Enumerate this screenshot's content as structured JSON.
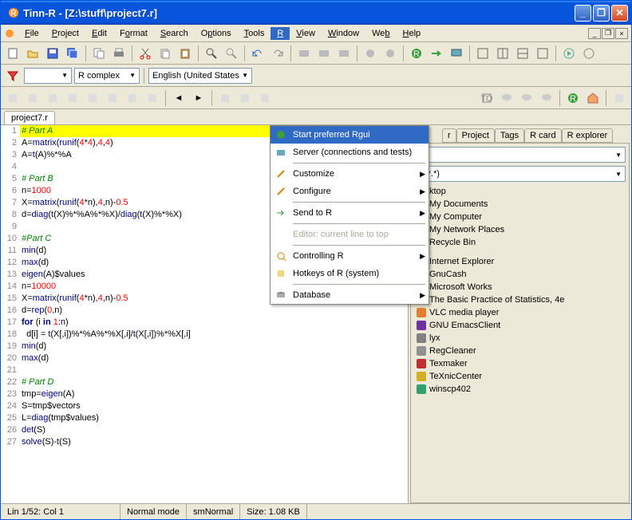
{
  "window": {
    "title": "Tinn-R - [Z:\\stuff\\project7.r]"
  },
  "menu": {
    "file": "File",
    "project": "Project",
    "edit": "Edit",
    "format": "Format",
    "search": "Search",
    "options": "Options",
    "tools": "Tools",
    "r": "R",
    "view": "View",
    "window": "Window",
    "web": "Web",
    "help": "Help"
  },
  "toolbar": {
    "combo1": "R complex",
    "combo2": "English (United States"
  },
  "editor": {
    "tab": "project7.r",
    "lines": [
      {
        "n": "1",
        "cls": "hl",
        "txt": "# Part A"
      },
      {
        "n": "2",
        "cls": "",
        "txt": "A=matrix(runif(4*4),4,4)"
      },
      {
        "n": "3",
        "cls": "",
        "txt": "A=t(A)%*%A"
      },
      {
        "n": "4",
        "cls": "",
        "txt": ""
      },
      {
        "n": "5",
        "cls": "cm",
        "txt": "# Part B"
      },
      {
        "n": "6",
        "cls": "",
        "txt": "n=1000"
      },
      {
        "n": "7",
        "cls": "",
        "txt": "X=matrix(runif(4*n),4,n)-0.5"
      },
      {
        "n": "8",
        "cls": "",
        "txt": "d=diag(t(X)%*%A%*%X)/diag(t(X)%*%X)"
      },
      {
        "n": "9",
        "cls": "",
        "txt": ""
      },
      {
        "n": "10",
        "cls": "cm",
        "txt": "#Part C"
      },
      {
        "n": "11",
        "cls": "",
        "txt": "min(d)"
      },
      {
        "n": "12",
        "cls": "",
        "txt": "max(d)"
      },
      {
        "n": "13",
        "cls": "",
        "txt": "eigen(A)$values"
      },
      {
        "n": "14",
        "cls": "",
        "txt": "n=10000"
      },
      {
        "n": "15",
        "cls": "",
        "txt": "X=matrix(runif(4*n),4,n)-0.5"
      },
      {
        "n": "16",
        "cls": "",
        "txt": "d=rep(0,n)"
      },
      {
        "n": "17",
        "cls": "",
        "txt": "for (i in 1:n)"
      },
      {
        "n": "18",
        "cls": "",
        "txt": "  d[i] = t(X[,i])%*%A%*%X[,i]/t(X[,i])%*%X[,i]"
      },
      {
        "n": "19",
        "cls": "",
        "txt": "min(d)"
      },
      {
        "n": "20",
        "cls": "",
        "txt": "max(d)"
      },
      {
        "n": "21",
        "cls": "",
        "txt": ""
      },
      {
        "n": "22",
        "cls": "cm",
        "txt": "# Part D"
      },
      {
        "n": "23",
        "cls": "",
        "txt": "tmp=eigen(A)"
      },
      {
        "n": "24",
        "cls": "",
        "txt": "S=tmp$vectors"
      },
      {
        "n": "25",
        "cls": "",
        "txt": "L=diag(tmp$values)"
      },
      {
        "n": "26",
        "cls": "",
        "txt": "det(S)"
      },
      {
        "n": "27",
        "cls": "",
        "txt": "solve(S)-t(S)"
      }
    ]
  },
  "rmenu": {
    "items": [
      {
        "label": "Start preferred Rgui",
        "hl": true,
        "arrow": false
      },
      {
        "label": "Server (connections and tests)",
        "arrow": false
      },
      {
        "sep": true
      },
      {
        "label": "Customize",
        "arrow": true
      },
      {
        "label": "Configure",
        "arrow": true
      },
      {
        "sep": true
      },
      {
        "label": "Send to R",
        "arrow": true
      },
      {
        "sep": true
      },
      {
        "label": "Editor: current line to top",
        "disabled": true
      },
      {
        "sep": true
      },
      {
        "label": "Controlling R",
        "arrow": true
      },
      {
        "label": "Hotkeys of R (system)",
        "arrow": false
      },
      {
        "sep": true
      },
      {
        "label": "Database",
        "arrow": true
      }
    ]
  },
  "side": {
    "tabs": [
      "r",
      "Project",
      "Tags",
      "R card",
      "R explorer"
    ],
    "combo1": "",
    "combo2": "ll (*.*)",
    "places": [
      "ktop",
      "My Documents",
      "My Computer",
      "My Network Places",
      "Recycle Bin"
    ],
    "apps": [
      "Internet Explorer",
      "GnuCash",
      "Microsoft Works",
      "The Basic Practice of Statistics, 4e",
      "VLC media player",
      "GNU EmacsClient",
      "lyx",
      "RegCleaner",
      "Texmaker",
      "TeXnicCenter",
      "winscp402"
    ]
  },
  "status": {
    "pos": "Lin 1/52: Col 1",
    "mode": "Normal mode",
    "sm": "smNormal",
    "size": "Size: 1.08 KB"
  }
}
